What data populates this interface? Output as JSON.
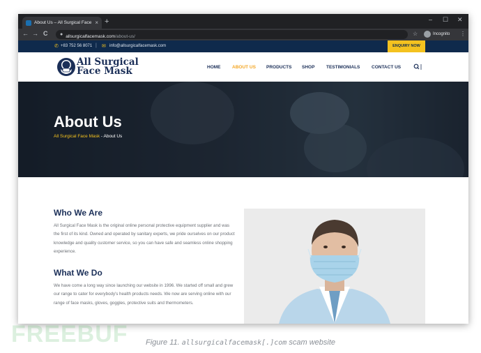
{
  "browser": {
    "tab_title": "About Us – All Surgical Face Mask",
    "tab_close": "×",
    "new_tab": "+",
    "url_host": "allsurgicalfacemask.com",
    "url_path": "/about-us/",
    "profile_label": "Incognito",
    "window_controls": {
      "minimize": "–",
      "maximize": "☐",
      "close": "✕"
    },
    "nav": {
      "back": "←",
      "forward": "→",
      "reload": "C"
    },
    "star": "☆",
    "menu": "⋮"
  },
  "topbar": {
    "phone": "+83 752 56 8071",
    "email": "info@allsurgicalfacemask.com",
    "separator": "|",
    "enquiry_label": "ENQUIRY NOW"
  },
  "header": {
    "logo_line1": "All Surgical",
    "logo_line2": "Face Mask",
    "nav_items": [
      {
        "label": "HOME"
      },
      {
        "label": "ABOUT US"
      },
      {
        "label": "PRODUCTS"
      },
      {
        "label": "SHOP"
      },
      {
        "label": "TESTIMONIALS"
      },
      {
        "label": "CONTACT US"
      }
    ],
    "search_icon": "search-icon",
    "active_nav": "ABOUT US"
  },
  "hero": {
    "title": "About Us",
    "breadcrumb_home": "All Surgical Face Mask",
    "breadcrumb_sep": " - ",
    "breadcrumb_current": "About Us"
  },
  "main": {
    "who_heading": "Who We Are",
    "who_text": "All Surgical Face Mask is the original online personal protective equipment supplier and was the first of its kind. Owned and operated by sanitary experts, we pride ourselves on our product knowledge and quality customer service, so you can have safe and seamless online shopping experience.",
    "what_heading": "What We Do",
    "what_text": "We have come a long way since launching our website in 1996. We started off small and grew our range to cater for everybody's health products needs. We now are serving online with our range of face masks, gloves, goggles, protective suits and thermometers."
  },
  "caption": {
    "prefix": "Figure 11. ",
    "domain": "allsurgicalfacemask[.]com",
    "suffix": " scam website"
  },
  "watermark": "FREEBUF",
  "colors": {
    "navy": "#0f2a4c",
    "accent_yellow": "#f4c21f",
    "nav_active": "#f4a623",
    "heading": "#1b2f58"
  }
}
